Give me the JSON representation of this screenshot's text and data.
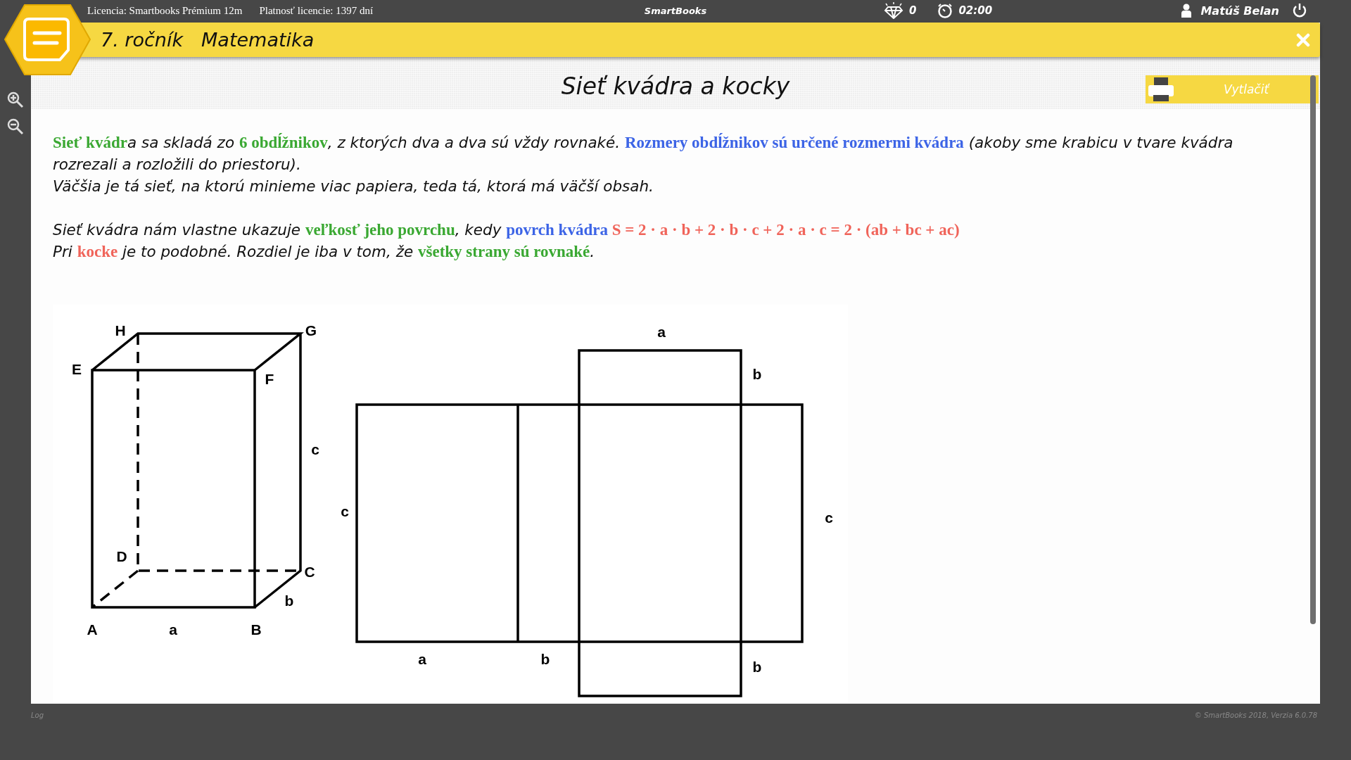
{
  "top_bar": {
    "license": "Licencia: Smartbooks Prémium 12m",
    "validity": "Platnosť licencie: 1397 dní",
    "app_name": "SmartBooks",
    "diamonds": "0",
    "timer": "02:00",
    "user": "Matúš Belan"
  },
  "title_bar": {
    "grade": "7. ročník",
    "subject": "Matematika"
  },
  "lesson": {
    "title": "Sieť kvádra a kocky",
    "print_button": "Vytlačiť",
    "paragraphs": [
      [
        {
          "text": "Sieť kvádr",
          "color": "#3aa832"
        },
        {
          "text": "a sa skladá zo "
        },
        {
          "text": "6 obdĺžnikov",
          "color": "#3aa832"
        },
        {
          "text": ", z ktorých dva a dva sú vždy rovnaké. "
        },
        {
          "text": "Rozmery obdĺžnikov sú určené rozmermi kvádra",
          "color": "#3c64e6"
        },
        {
          "text": " (akoby sme krabicu v tvare kvádra rozrezali a rozložili do priestoru)."
        }
      ],
      [
        {
          "text": "Väčšia je tá sieť, na ktorú minieme viac papiera, teda tá, ktorá má väčší obsah."
        }
      ],
      [
        {
          "text": "Sieť kvádra nám vlastne ukazuje "
        },
        {
          "text": "veľkosť jeho povrchu",
          "color": "#3aa832"
        },
        {
          "text": ", kedy "
        },
        {
          "text": "povrch kvádra ",
          "color": "#3c64e6"
        },
        {
          "text": "S = 2 · a · b + 2 · b · c + 2 · a · c = 2 · (ab + bc + ac)",
          "color": "#f0645a"
        }
      ],
      [
        {
          "text": "Pri "
        },
        {
          "text": "kocke",
          "color": "#f0645a"
        },
        {
          "text": " je to podobné. Rozdiel je iba v tom, že "
        },
        {
          "text": "všetky strany sú rovnaké",
          "color": "#3aa832"
        },
        {
          "text": "."
        }
      ]
    ],
    "cuboid_labels": [
      "H",
      "G",
      "E",
      "F",
      "c",
      "D",
      "C",
      "b",
      "A",
      "a",
      "B"
    ],
    "net_labels": [
      "a",
      "b",
      "c",
      "c",
      "a",
      "b",
      "b"
    ]
  },
  "footer": {
    "log": "Log",
    "version": "© SmartBooks 2018, Verzia 6.0.78"
  }
}
